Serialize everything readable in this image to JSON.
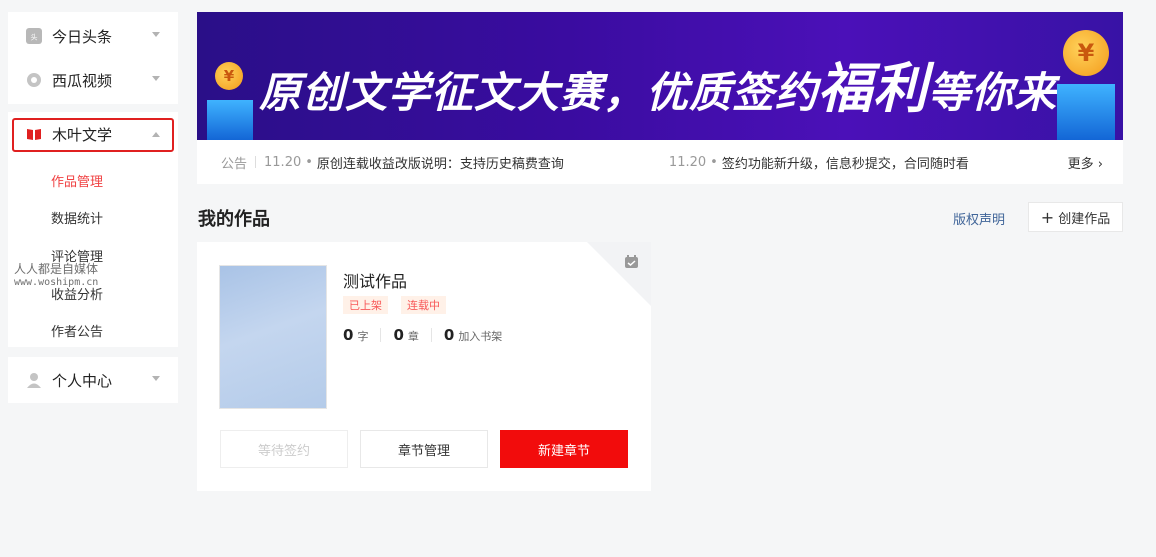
{
  "sidebar": {
    "top_items": [
      {
        "label": "今日头条",
        "icon": "toutiao-logo-icon"
      },
      {
        "label": "西瓜视频",
        "icon": "xigua-logo-icon"
      }
    ],
    "section": {
      "label": "木叶文学",
      "icon": "book-icon",
      "sub_items": [
        "作品管理",
        "数据统计",
        "评论管理",
        "收益分析",
        "作者公告"
      ],
      "active_sub": "作品管理"
    },
    "personal": {
      "label": "个人中心",
      "icon": "user-icon"
    }
  },
  "watermark": {
    "line1": "人人都是自媒体",
    "line2": "www.woshipm.cn"
  },
  "banner": {
    "text_part1": "原创文学征文大赛，优质签约",
    "text_big": "福利",
    "text_part2": "等你来",
    "coin_left": "¥",
    "coin_right": "¥"
  },
  "notices": {
    "label": "公告",
    "items": [
      {
        "date": "11.20",
        "text": "原创连载收益改版说明：支持历史稿费查询"
      },
      {
        "date": "11.20",
        "text": "签约功能新升级，信息秒提交，合同随时看"
      }
    ],
    "more": "更多"
  },
  "works": {
    "title": "我的作品",
    "copyright_link": "版权声明",
    "create_button": "创建作品",
    "items": [
      {
        "name": "测试作品",
        "tags": [
          "已上架",
          "连载中"
        ],
        "stats": [
          {
            "value": "0",
            "unit": "字"
          },
          {
            "value": "0",
            "unit": "章"
          },
          {
            "value": "0",
            "unit": "加入书架"
          }
        ],
        "buttons": {
          "pending": "等待签约",
          "manage": "章节管理",
          "new": "新建章节"
        }
      }
    ]
  },
  "colors": {
    "accent": "#f04142",
    "primary_button": "#f20c0c",
    "link": "#406599",
    "banner": "#3a0ca0"
  }
}
